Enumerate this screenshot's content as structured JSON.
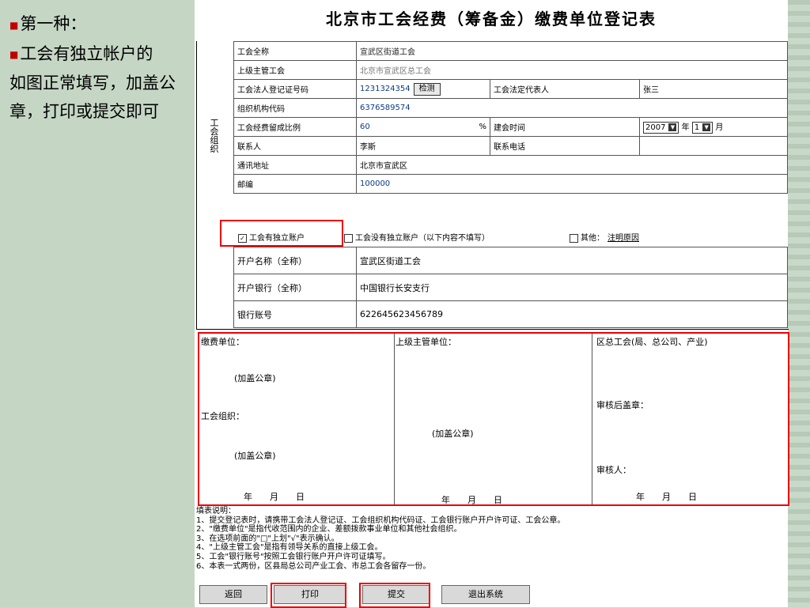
{
  "left_panel": {
    "line1": "第一种：",
    "line2": "工会有独立帐户的",
    "line3": "如图正常填写，加盖公章，打印或提交即可"
  },
  "form": {
    "title": "北京市工会经费（筹备金）缴费单位登记表",
    "side_label": "工会组织",
    "rows": {
      "union_name_label": "工会全称",
      "union_name_value": "宣武区街道工会",
      "superior_label": "上级主管工会",
      "superior_value": "北京市宣武区总工会",
      "reg_no_label": "工会法人登记证号码",
      "reg_no_value": "1231324354",
      "check_button": "检测",
      "legal_rep_label": "工会法定代表人",
      "legal_rep_value": "张三",
      "org_code_label": "组织机构代码",
      "org_code_value": "6376589574",
      "ratio_label": "工会经费留成比例",
      "ratio_value": "60",
      "ratio_unit": "%",
      "founded_label": "建会时间",
      "founded_year": "2007",
      "year_text": "年",
      "founded_month": "1",
      "month_text": "月",
      "contact_label": "联系人",
      "contact_value": "李斯",
      "phone_label": "联系电话",
      "phone_value": "",
      "address_label": "通讯地址",
      "address_value": "北京市宣武区",
      "zip_label": "邮编",
      "zip_value": "100000"
    },
    "options": {
      "independent_account": "工会有独立账户",
      "no_account": "工会没有独立账户（以下内容不填写）",
      "other": "其他：",
      "other_link": "注明原因"
    },
    "account": {
      "name_label": "开户名称（全称）",
      "name_value": "宣武区街道工会",
      "bank_label": "开户银行（全称）",
      "bank_value": "中国银行长安支行",
      "number_label": "银行账号",
      "number_value": "622645623456789"
    },
    "signatures": {
      "payer_unit": "缴费单位：",
      "stamp1": "(加盖公章)",
      "union_org": "工会组织：",
      "stamp2": "(加盖公章)",
      "date1": "年　　月　　日",
      "superior_unit": "上级主管单位：",
      "stamp3": "(加盖公章)",
      "date2": "年　　月　　日",
      "district": "区总工会(局、总公司、产业)",
      "after_review": "审核后盖章：",
      "reviewer": "审核人：",
      "date3": "年　　月　　日"
    },
    "notes": [
      "填表说明：",
      "1、提交登记表时，请携带工会法人登记证、工会组织机构代码证、工会银行账户开户许可证、工会公章。",
      "2、\"缴费单位\"是指代收范围内的企业、差额拨款事业单位和其他社会组织。",
      "3、在选项前面的\"□\"上划\"√\"表示确认。",
      "4、\"上级主管工会\"是指有领导关系的直接上级工会。",
      "5、工会\"银行账号\"按照工会银行账户开户许可证填写。",
      "6、本表一式两份，区县局总公司产业工会、市总工会各留存一份。"
    ],
    "buttons": {
      "back": "返回",
      "print": "打印",
      "submit": "提交",
      "exit": "退出系统"
    }
  }
}
